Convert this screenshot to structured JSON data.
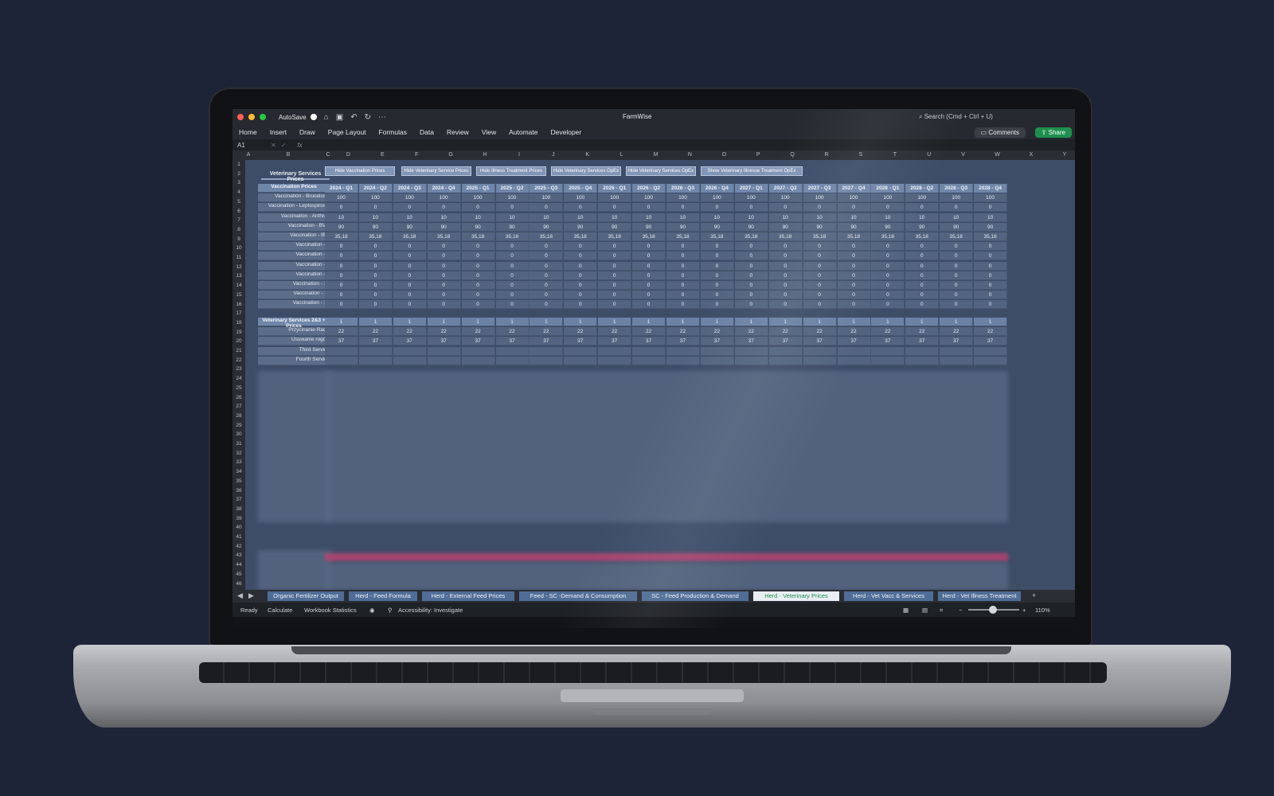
{
  "window": {
    "autosave_label": "AutoSave",
    "document_title": "FarmWise",
    "search_placeholder": "Search (Cmd + Ctrl + U)",
    "comments_label": "Comments",
    "share_label": "Share"
  },
  "ribbon": {
    "tabs": [
      "Home",
      "Insert",
      "Draw",
      "Page Layout",
      "Formulas",
      "Data",
      "Review",
      "View",
      "Automate",
      "Developer"
    ]
  },
  "formula_bar": {
    "cell_ref": "A1",
    "fx": "fx"
  },
  "columns": [
    "A",
    "B",
    "C",
    "D",
    "E",
    "F",
    "G",
    "H",
    "I",
    "J",
    "K",
    "L",
    "M",
    "N",
    "O",
    "P",
    "Q",
    "R",
    "S",
    "T",
    "U",
    "V",
    "W",
    "X",
    "Y"
  ],
  "rows": [
    "1",
    "2",
    "3",
    "4",
    "5",
    "6",
    "7",
    "8",
    "9",
    "10",
    "11",
    "12",
    "13",
    "14",
    "15",
    "16",
    "17",
    "18",
    "19",
    "20",
    "21",
    "22",
    "23",
    "24",
    "25",
    "26",
    "27",
    "28",
    "29",
    "30",
    "31",
    "32",
    "33",
    "34",
    "35",
    "36",
    "37",
    "38",
    "39",
    "40",
    "41",
    "42",
    "43",
    "44",
    "45",
    "46"
  ],
  "sheet": {
    "section_title": "Veterinary Services Prices",
    "buttons": [
      "Hide Vaccination Prices",
      "Hide Veterinary Service Prices",
      "Hide Illness Treatment Prices",
      "Hide Veterinary Services OpEx",
      "Hide Veterinary Services OpEx",
      "Show Veterinary Illnesse Treatment OpEx"
    ],
    "quarters": [
      "2024 - Q1",
      "2024 - Q2",
      "2024 - Q3",
      "2024 - Q4",
      "2025 - Q1",
      "2025 - Q2",
      "2025 - Q3",
      "2025 - Q4",
      "2026 - Q1",
      "2026 - Q2",
      "2026 - Q3",
      "2026 - Q4",
      "2027 - Q1",
      "2027 - Q2",
      "2027 - Q3",
      "2027 - Q4",
      "2028 - Q1",
      "2028 - Q2",
      "2028 - Q3",
      "2028 - Q4"
    ],
    "vaccination_header": "Vaccination Prices",
    "vaccination_rows": [
      {
        "label": "Vaccination - Brucelosis",
        "value": "100"
      },
      {
        "label": "Vaccination - Leptospirosis",
        "value": "0"
      },
      {
        "label": "Vaccination - Anthrax",
        "value": "10"
      },
      {
        "label": "Vaccination - BVD",
        "value": "90"
      },
      {
        "label": "Vaccination - IBR",
        "value": "35,18"
      },
      {
        "label": "Vaccination - 6",
        "value": "0"
      },
      {
        "label": "Vaccination - 7",
        "value": "0"
      },
      {
        "label": "Vaccination - 8",
        "value": "0"
      },
      {
        "label": "Vaccination - 9",
        "value": "0"
      },
      {
        "label": "Vaccination - 10",
        "value": "0"
      },
      {
        "label": "Vaccination - 11",
        "value": "0"
      },
      {
        "label": "Vaccination - 12",
        "value": "0"
      }
    ],
    "services_header": "Veterinary Services 2&3 + Prices",
    "services_header_value": "1",
    "services_rows": [
      {
        "label": "Przycinanie Racic",
        "value": "22"
      },
      {
        "label": "Usuwanie rogów",
        "value": "37"
      },
      {
        "label": "Third Service",
        "value": ""
      },
      {
        "label": "Fourth Service",
        "value": ""
      }
    ]
  },
  "sheet_tabs": [
    {
      "label": "Organic Fertilizer Output",
      "active": false
    },
    {
      "label": "Herd - Feed Formula",
      "active": false
    },
    {
      "label": "Herd - External Feed Prices",
      "active": false
    },
    {
      "label": "Feed - SC -Demand & Consumption",
      "active": false
    },
    {
      "label": "SC - Feed Production & Demand",
      "active": false
    },
    {
      "label": "Herd - Veterinary Prices",
      "active": true
    },
    {
      "label": "Herd - Vet Vacc & Services",
      "active": false
    },
    {
      "label": "Herd - Vet Illness Treatment",
      "active": false
    }
  ],
  "status": {
    "ready": "Ready",
    "calculate": "Calculate",
    "workbook_statistics": "Workbook Statistics",
    "accessibility": "Accessibility: Investigate",
    "zoom": "110%"
  },
  "colors": {
    "desk": "#1d2438",
    "sheet_bg": "#3d4d68",
    "header_fill": "#7086a9",
    "active_tab_text": "#1e8f4e",
    "share": "#1e8f4e"
  }
}
